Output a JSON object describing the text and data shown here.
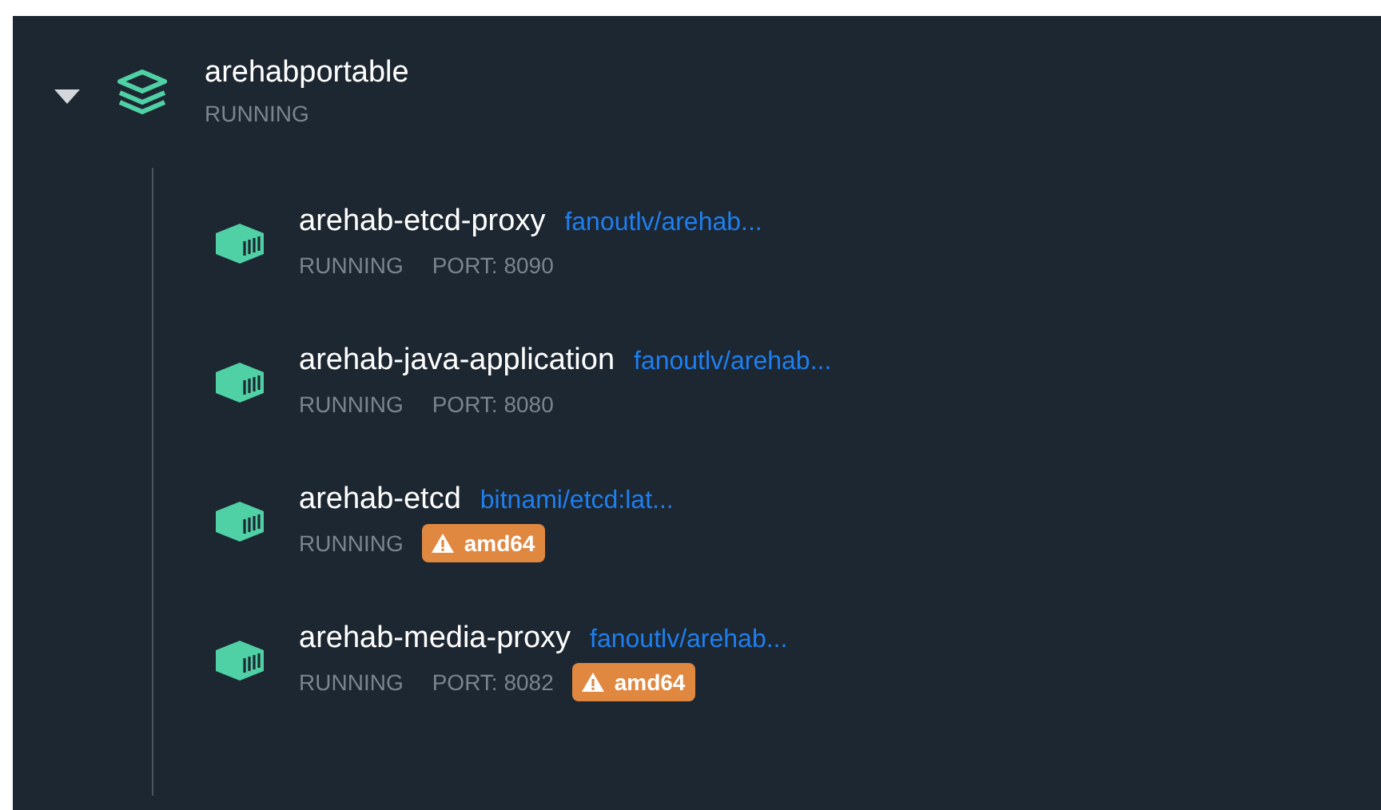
{
  "stack": {
    "name": "arehabportable",
    "status": "RUNNING",
    "expanded": true,
    "containers": [
      {
        "name": "arehab-etcd-proxy",
        "image": "fanoutlv/arehab...",
        "status": "RUNNING",
        "port": "PORT: 8090"
      },
      {
        "name": "arehab-java-application",
        "image": "fanoutlv/arehab...",
        "status": "RUNNING",
        "port": "PORT: 8080"
      },
      {
        "name": "arehab-etcd",
        "image": "bitnami/etcd:lat...",
        "status": "RUNNING",
        "warning": "amd64"
      },
      {
        "name": "arehab-media-proxy",
        "image": "fanoutlv/arehab...",
        "status": "RUNNING",
        "port": "PORT: 8082",
        "warning": "amd64"
      }
    ]
  }
}
